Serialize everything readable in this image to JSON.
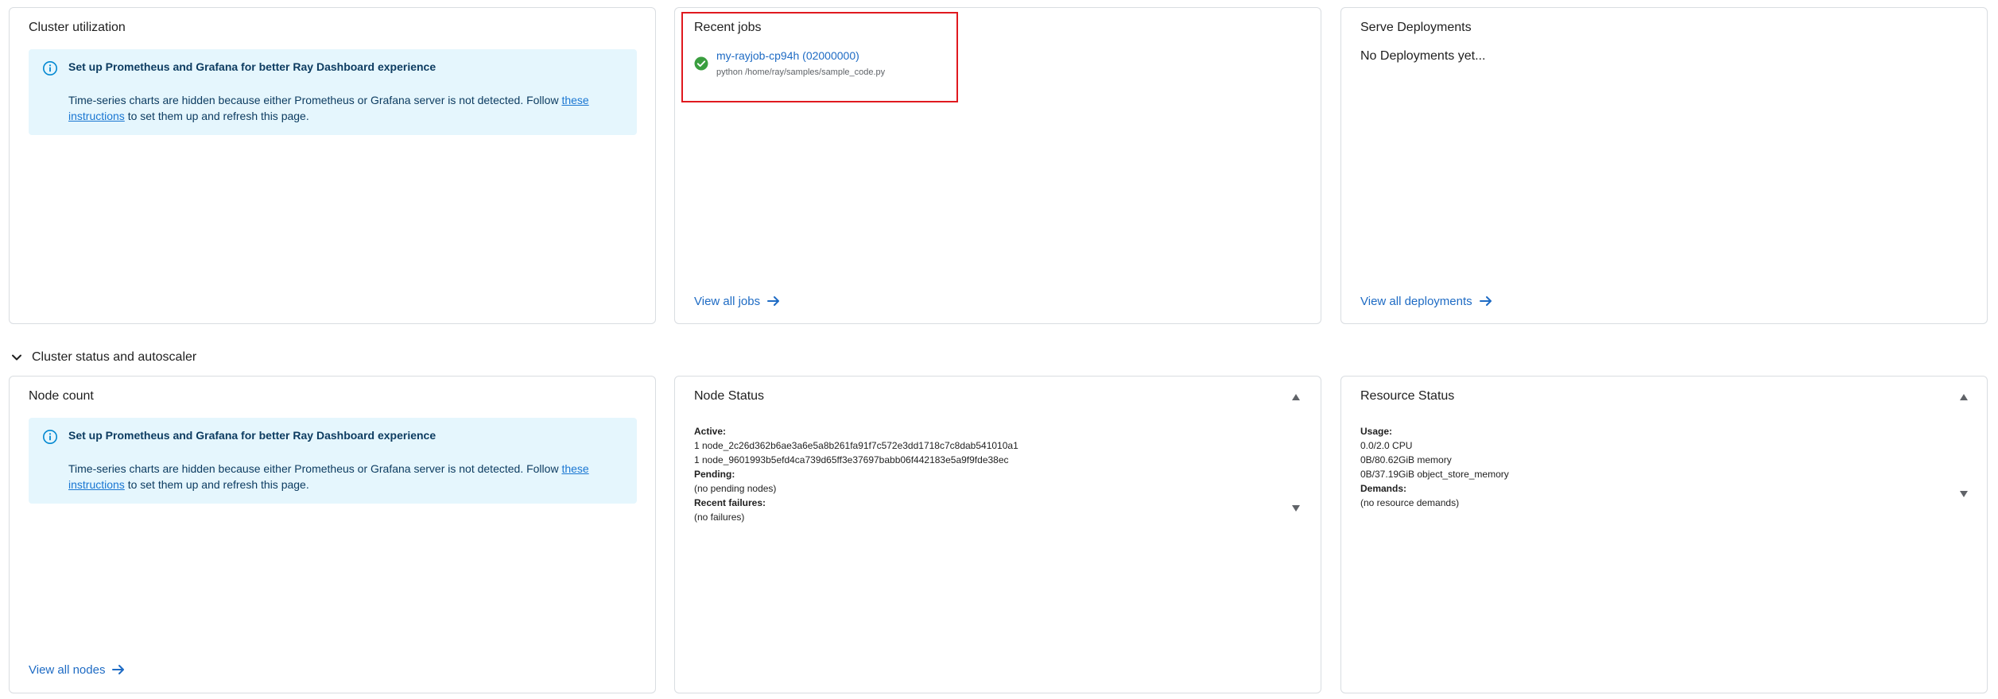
{
  "cluster_utilization": {
    "title": "Cluster utilization",
    "alert_title": "Set up Prometheus and Grafana for better Ray Dashboard experience",
    "alert_text_before": "Time-series charts are hidden because either Prometheus or Grafana server is not detected. Follow ",
    "alert_link": "these instructions",
    "alert_text_after": " to set them up and refresh this page."
  },
  "recent_jobs": {
    "title": "Recent jobs",
    "jobs": [
      {
        "name": "my-rayjob-cp94h (02000000)",
        "entrypoint": "python /home/ray/samples/sample_code.py",
        "status_icon": "check-circle-icon",
        "status_color": "#3a9e3f"
      }
    ],
    "view_all": "View all jobs"
  },
  "serve_deployments": {
    "title": "Serve Deployments",
    "empty_text": "No Deployments yet...",
    "view_all": "View all deployments"
  },
  "section": {
    "title": "Cluster status and autoscaler",
    "toggle_icon": "chevron-down-icon"
  },
  "node_count": {
    "title": "Node count",
    "alert_title": "Set up Prometheus and Grafana for better Ray Dashboard experience",
    "alert_text_before": "Time-series charts are hidden because either Prometheus or Grafana server is not detected. Follow ",
    "alert_link": "these instructions",
    "alert_text_after": " to set them up and refresh this page.",
    "view_all": "View all nodes"
  },
  "node_status": {
    "title": "Node Status",
    "lines": [
      {
        "text": "Active:",
        "bold": true
      },
      {
        "text": "1 node_2c26d362b6ae3a6e5a8b261fa91f7c572e3dd1718c7c8dab541010a1",
        "bold": false
      },
      {
        "text": "1 node_9601993b5efd4ca739d65ff3e37697babb06f442183e5a9f9fde38ec",
        "bold": false
      },
      {
        "text": "Pending:",
        "bold": true
      },
      {
        "text": "(no pending nodes)",
        "bold": false
      },
      {
        "text": "Recent failures:",
        "bold": true
      },
      {
        "text": "(no failures)",
        "bold": false
      }
    ]
  },
  "resource_status": {
    "title": "Resource Status",
    "lines": [
      {
        "text": "Usage:",
        "bold": true
      },
      {
        "text": "0.0/2.0 CPU",
        "bold": false
      },
      {
        "text": "0B/80.62GiB memory",
        "bold": false
      },
      {
        "text": "0B/37.19GiB object_store_memory",
        "bold": false
      },
      {
        "text": "Demands:",
        "bold": true
      },
      {
        "text": "(no resource demands)",
        "bold": false
      }
    ]
  },
  "colors": {
    "link": "#1e6bc4",
    "alert_bg": "#e5f6fd",
    "alert_text": "#0d3c61",
    "highlight_border": "#e0191f",
    "success": "#3a9e3f"
  }
}
